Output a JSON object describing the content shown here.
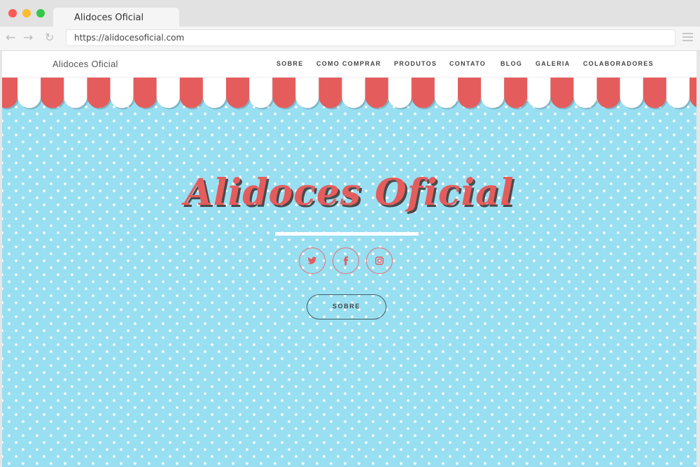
{
  "browser": {
    "tab_title": "Alidoces Oficial",
    "url": "https://alidocesoficial.com",
    "back_icon": "arrow-left-icon",
    "forward_icon": "arrow-right-icon",
    "reload_icon": "reload-icon",
    "menu_icon": "hamburger-menu-icon"
  },
  "site": {
    "brand": "Alidoces Oficial",
    "nav": [
      "SOBRE",
      "COMO COMPRAR",
      "PRODUTOS",
      "CONTATO",
      "BLOG",
      "GALERIA",
      "COLABORADORES"
    ]
  },
  "hero": {
    "title": "Alidoces Oficial",
    "social": [
      "twitter-icon",
      "facebook-icon",
      "instagram-icon"
    ],
    "cta_label": "SOBRE"
  },
  "colors": {
    "background": "#99dff2",
    "accent_red": "#e55c5c",
    "awning_red": "#e55c5c",
    "awning_white": "#ffffff"
  }
}
